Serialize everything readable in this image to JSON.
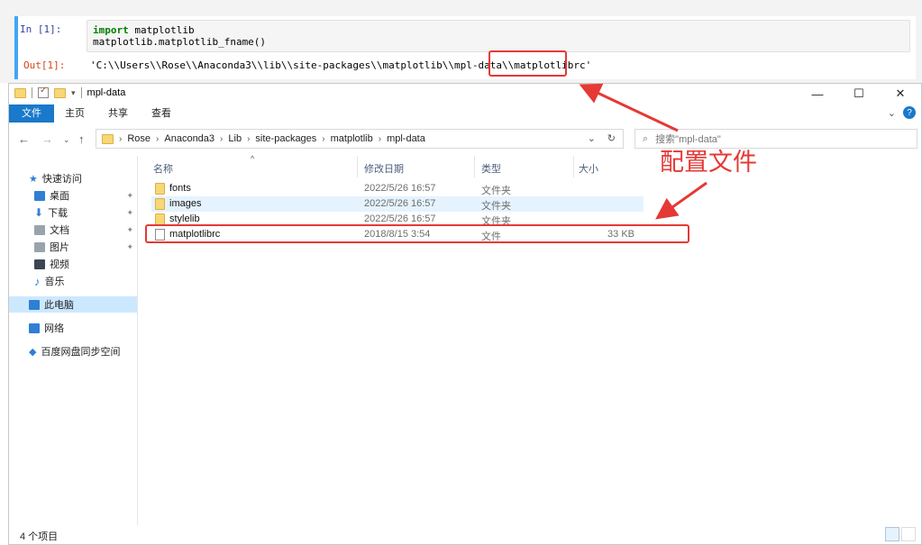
{
  "jupyter": {
    "in_prompt": "In  [1]:",
    "code_kw": "import",
    "code_line1_rest": " matplotlib",
    "code_line2": "matplotlib.matplotlib_fname()",
    "out_prompt": "Out[1]:",
    "output": "'C:\\\\Users\\\\Rose\\\\Anaconda3\\\\lib\\\\site-packages\\\\matplotlib\\\\mpl-data\\\\matplotlibrc'"
  },
  "explorer": {
    "title": "mpl-data",
    "window_controls": [
      "—",
      "☐",
      "✕"
    ],
    "ribbon_tabs": [
      "文件",
      "主页",
      "共享",
      "查看"
    ],
    "breadcrumbs": [
      "Rose",
      "Anaconda3",
      "Lib",
      "site-packages",
      "matplotlib",
      "mpl-data"
    ],
    "search_placeholder": "搜索\"mpl-data\"",
    "nav_quick_access": "快速访问",
    "nav_items": [
      "桌面",
      "下载",
      "文档",
      "图片",
      "视频",
      "音乐"
    ],
    "nav_this_pc": "此电脑",
    "nav_network": "网络",
    "nav_baidu": "百度网盘同步空间",
    "columns": {
      "name": "名称",
      "date": "修改日期",
      "type": "类型",
      "size": "大小"
    },
    "files": [
      {
        "name": "fonts",
        "date": "2022/5/26 16:57",
        "type": "文件夹",
        "size": "",
        "kind": "folder"
      },
      {
        "name": "images",
        "date": "2022/5/26 16:57",
        "type": "文件夹",
        "size": "",
        "kind": "folder"
      },
      {
        "name": "stylelib",
        "date": "2022/5/26 16:57",
        "type": "文件夹",
        "size": "",
        "kind": "folder"
      },
      {
        "name": "matplotlibrc",
        "date": "2018/8/15 3:54",
        "type": "文件",
        "size": "33 KB",
        "kind": "file"
      }
    ],
    "status_count": "4 个项目"
  },
  "annotation": {
    "label": "配置文件",
    "color": "#e53935"
  },
  "colors": {
    "accent": "#1979ca",
    "cell_border": "#42a5f5",
    "selected_row": "#e5f3ff",
    "nav_active": "#cce8ff"
  }
}
